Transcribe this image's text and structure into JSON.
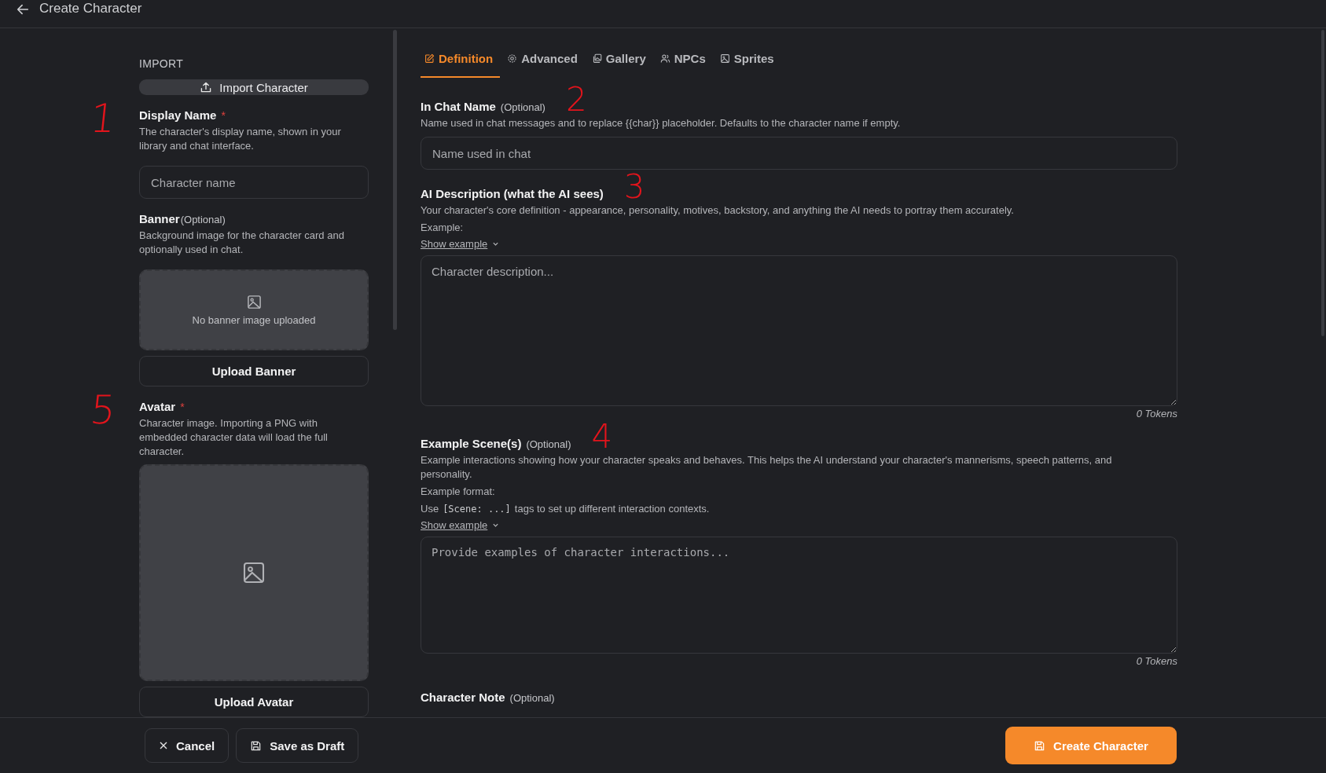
{
  "header": {
    "title": "Create Character"
  },
  "import": {
    "heading": "IMPORT",
    "button": "Import Character"
  },
  "display_name": {
    "label": "Display Name",
    "required": "*",
    "annotation": "1",
    "help": "The character's display name, shown in your library and chat interface.",
    "placeholder": "Character name"
  },
  "banner": {
    "label": "Banner",
    "optional": "(Optional)",
    "help": "Background image for the character card and optionally used in chat.",
    "empty_text": "No banner image uploaded",
    "button": "Upload Banner"
  },
  "avatar": {
    "label": "Avatar",
    "required": "*",
    "annotation": "5",
    "help": "Character image. Importing a PNG with embedded character data will load the full character.",
    "button": "Upload Avatar"
  },
  "tabs": [
    {
      "label": "Definition",
      "selected": true
    },
    {
      "label": "Advanced",
      "selected": false
    },
    {
      "label": "Gallery",
      "selected": false
    },
    {
      "label": "NPCs",
      "selected": false
    },
    {
      "label": "Sprites",
      "selected": false
    }
  ],
  "sections": [
    {
      "kind": "input",
      "label": "In Chat Name",
      "optional": "(Optional)",
      "annotation": "2",
      "help": [
        "Name used in chat messages and to replace {{char}} placeholder. Defaults to the character name if empty."
      ],
      "placeholder": "Name used in chat"
    },
    {
      "kind": "textarea",
      "label": "AI Description (what the AI sees)",
      "annotation": "3",
      "help": [
        "Your character's core definition - appearance, personality, motives, backstory, and anything the AI needs to portray them accurately.",
        "Example:"
      ],
      "show_example": "Show example",
      "placeholder": "Character description...",
      "mono": false,
      "tokens": "0 Tokens"
    },
    {
      "kind": "textarea",
      "label": "Example Scene(s)",
      "optional": "(Optional)",
      "annotation": "4",
      "help": [
        "Example interactions showing how your character speaks and behaves. This helps the AI understand your character's mannerisms, speech patterns, and personality.",
        "Example format:"
      ],
      "usage": {
        "before": "Use",
        "code": "[Scene: ...]",
        "after": "tags to set up different interaction contexts."
      },
      "show_example": "Show example",
      "placeholder": "Provide examples of character interactions...",
      "mono": true,
      "tokens": "0 Tokens"
    },
    {
      "kind": "heading",
      "label": "Character Note",
      "optional": "(Optional)"
    }
  ],
  "footer": {
    "cancel": "Cancel",
    "draft": "Save as Draft",
    "create": "Create Character"
  }
}
